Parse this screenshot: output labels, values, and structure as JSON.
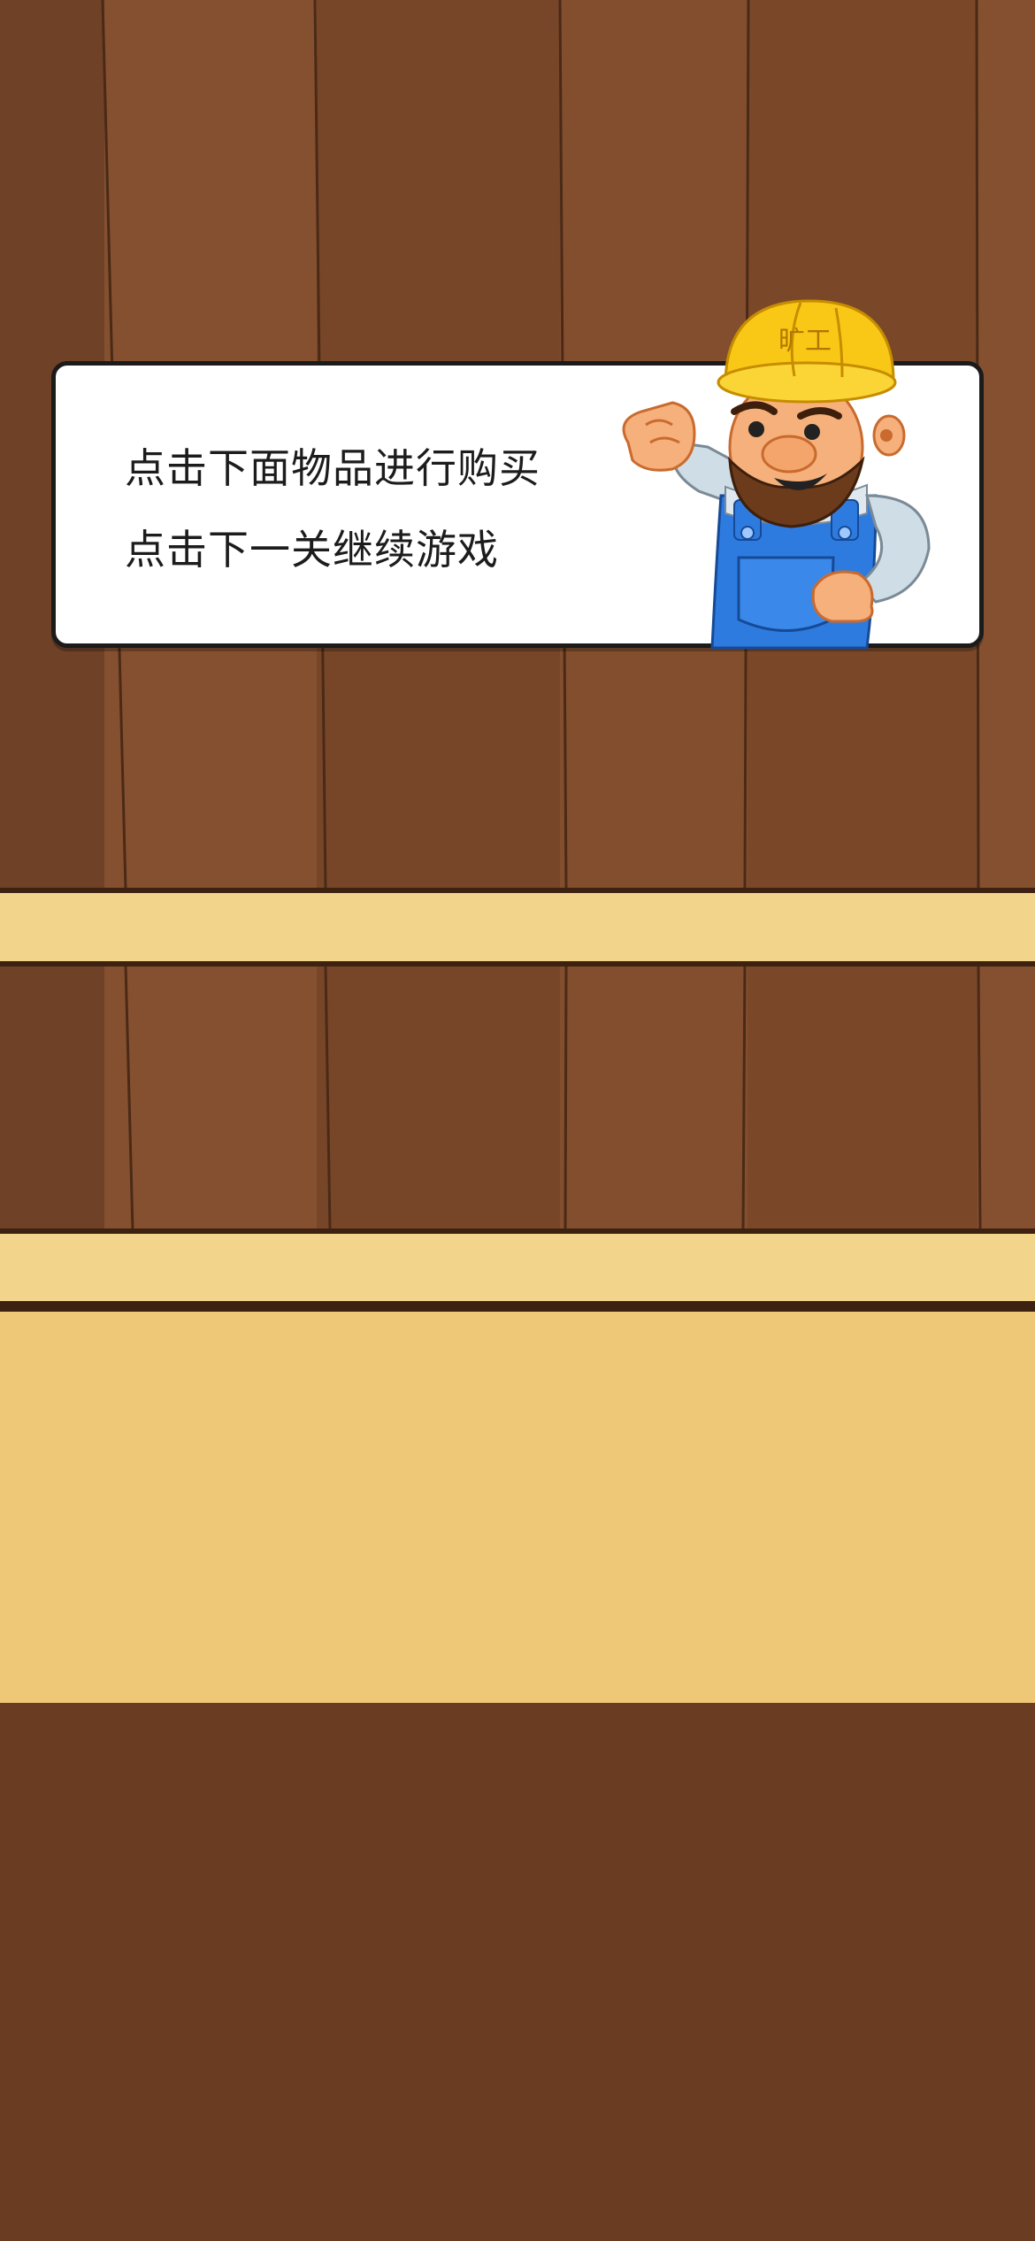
{
  "dialog": {
    "line1": "点击下面物品进行购买",
    "line2": "点击下一关继续游戏"
  },
  "mascot": {
    "helmet_text": "旷工",
    "icon": "miner-mascot"
  },
  "colors": {
    "wood_plank": "#7a4a2c",
    "wood_plank_light": "#85502f",
    "wood_seam": "#4a2a16",
    "shelf": "#f2d58a",
    "counter": "#efc877",
    "floor": "#6a3d22",
    "helmet": "#f9c816",
    "overalls": "#2e7be0"
  }
}
